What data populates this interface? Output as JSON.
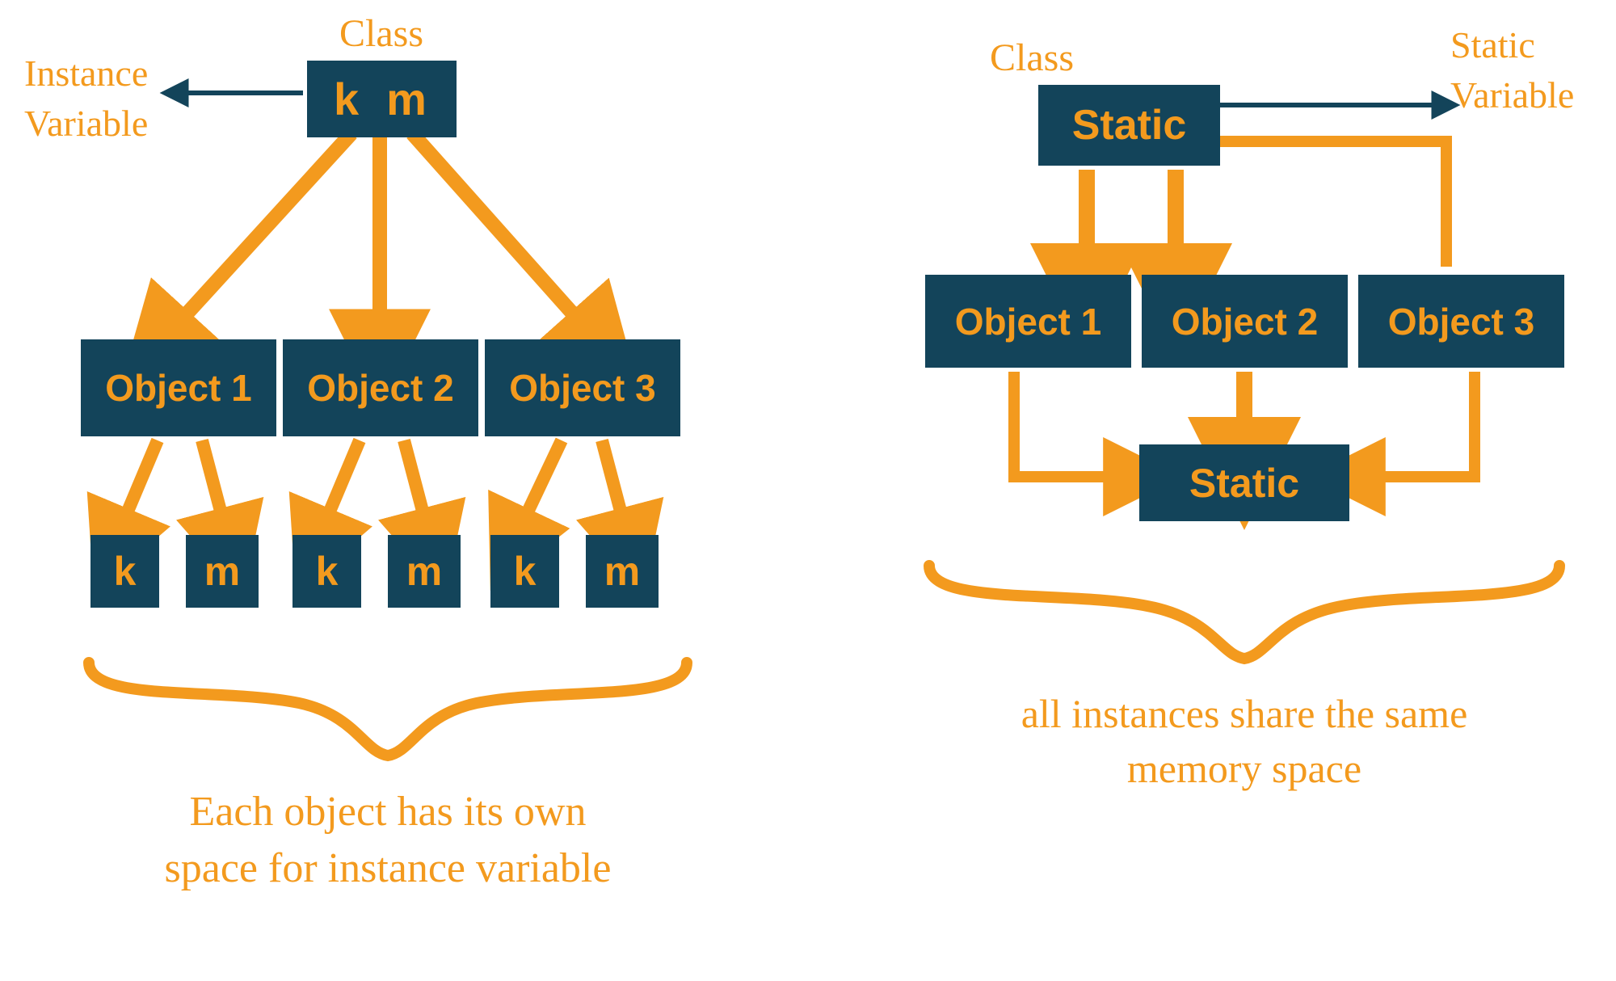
{
  "colors": {
    "box_bg": "#13445a",
    "accent": "#f39a1e",
    "dark_arrow": "#13445a"
  },
  "left": {
    "class_label": "Class",
    "side_label": "Instance\nVariable",
    "class_vars": {
      "k": "k",
      "m": "m"
    },
    "objects": [
      "Object 1",
      "Object 2",
      "Object 3"
    ],
    "var_labels": {
      "k": "k",
      "m": "m"
    },
    "caption": "Each object has its own\nspace for instance variable"
  },
  "right": {
    "class_label": "Class",
    "side_label": "Static\nVariable",
    "class_box": "Static",
    "objects": [
      "Object 1",
      "Object 2",
      "Object 3"
    ],
    "shared_box": "Static",
    "caption": "all instances share the same\nmemory space"
  }
}
